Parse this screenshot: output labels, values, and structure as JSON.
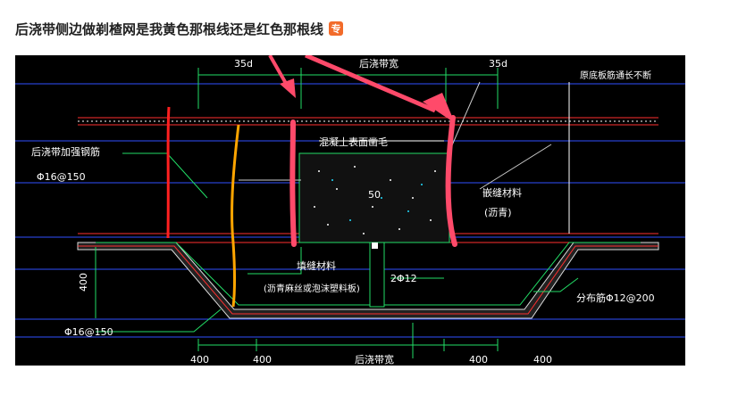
{
  "question": {
    "title": "后浇带侧边做剃楂网是我黄色那根线还是红色那根线",
    "badge_label": "专",
    "badge_color": "#f26b2a"
  },
  "drawing": {
    "labels": {
      "dim_left_top": "35d",
      "dim_right_top": "35d",
      "post_pour_width_top": "后浇带宽",
      "floor_slab_rebar": "原底板筋通长不断",
      "additional_rebar_title": "后浇带加强钢筋",
      "additional_rebar_spec": "Φ16@150",
      "concrete_surface": "混凝土表面凿毛",
      "dim_50": "50",
      "sealing_material": "嵌缝材料",
      "sealing_material_note": "(沥青)",
      "filler_material": "填缝材料",
      "filler_material_note": "(沥青麻丝或泡沫塑料板)",
      "rebar_2phi12": "2Φ12",
      "dim_400_left_vertical": "400",
      "bottom_rebar_spec": "Φ16@150",
      "distribution_rebar": "分布筋Φ12@200",
      "dim_bottom_1": "400",
      "dim_bottom_2": "400",
      "dim_bottom_3": "400",
      "dim_bottom_4": "400",
      "post_pour_width_bottom": "后浇带宽"
    },
    "annotation_colors": {
      "red_line": "#ff2020",
      "yellow_line": "#ffa500",
      "pink_arrow": "#ff4a6a"
    }
  }
}
